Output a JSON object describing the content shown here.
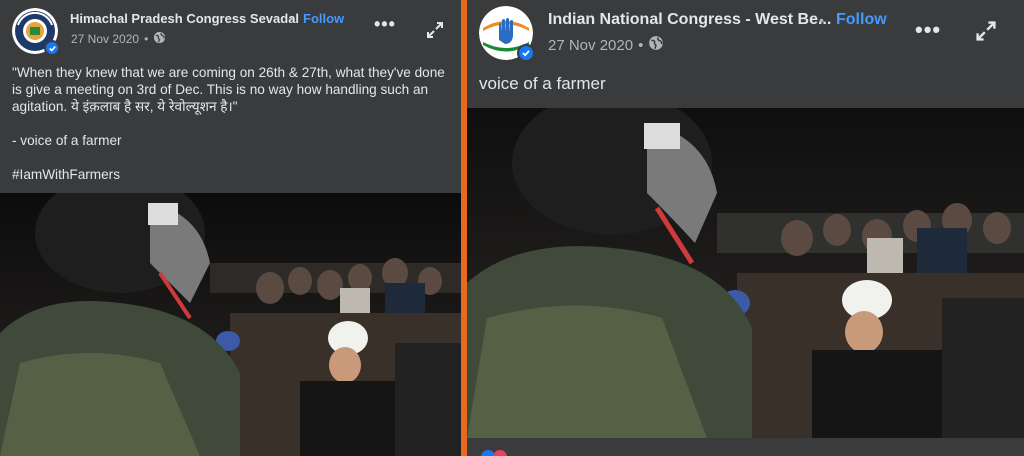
{
  "left_post": {
    "page_name": "Himachal Pradesh Congress Sevadal",
    "follow_label": "Follow",
    "separator": "•",
    "date": "27 Nov 2020",
    "paragraphs": [
      "\"When they knew that we are coming on 26th & 27th, what they've done is give a meeting on 3rd of Dec. This is no way how handling such an agitation. ये इंक़लाब है सर, ये रेवोल्यूशन है।\"",
      "- voice of a farmer",
      "#IamWithFarmers"
    ],
    "avatar_icon": "stay-home-logo-icon",
    "privacy_icon": "globe-icon"
  },
  "right_post": {
    "page_name": "Indian National Congress - West Be...",
    "follow_label": "Follow",
    "separator": "•",
    "date": "27 Nov 2020",
    "text": "voice of a farmer",
    "avatar_icon": "congress-hand-logo-icon",
    "privacy_icon": "globe-icon"
  },
  "colors": {
    "panel_bg": "#3a3b3c",
    "divider": "#e86a1e",
    "follow": "#4599ff",
    "verified": "#1877f2",
    "text": "#e4e6eb",
    "muted": "#b0b3b8"
  }
}
